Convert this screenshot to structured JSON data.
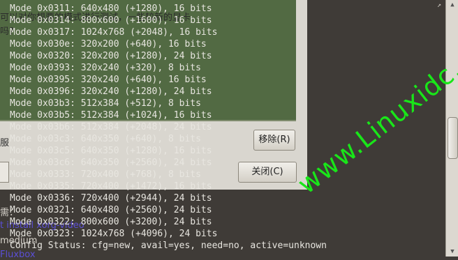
{
  "background_window": {
    "text_line_1": "可以对你想要的模式进行测试，一些较新的显卡",
    "text_line_2": "吗？",
    "text_line_3": "服",
    "text_line_4": "需：",
    "remove_button": "移除(R)",
    "close_button": "关闭(C)"
  },
  "background_page": {
    "link_text": "t install xorg-video",
    "word_1": "medium",
    "word_2": "Fluxbox"
  },
  "terminal": {
    "lines": [
      "Mode 0x0311: 640x480 (+1280), 16 bits",
      "Mode 0x0314: 800x600 (+1600), 16 bits",
      "Mode 0x0317: 1024x768 (+2048), 16 bits",
      "Mode 0x030e: 320x200 (+640), 16 bits",
      "Mode 0x0320: 320x200 (+1280), 24 bits",
      "Mode 0x0393: 320x240 (+320), 8 bits",
      "Mode 0x0395: 320x240 (+640), 16 bits",
      "Mode 0x0396: 320x240 (+1280), 24 bits",
      "Mode 0x03b3: 512x384 (+512), 8 bits",
      "Mode 0x03b5: 512x384 (+1024), 16 bits",
      "Mode 0x03b6: 512x384 (+2048), 24 bits",
      "Mode 0x03c3: 640x350 (+640), 8 bits",
      "Mode 0x03c5: 640x350 (+1280), 16 bits",
      "Mode 0x03c6: 640x350 (+2560), 24 bits",
      "Mode 0x0333: 720x400 (+768), 8 bits",
      "Mode 0x0335: 720x400 (+1472), 16 bits",
      "Mode 0x0336: 720x400 (+2944), 24 bits",
      "Mode 0x0321: 640x480 (+2560), 24 bits",
      "Mode 0x0322: 800x600 (+3200), 24 bits",
      "Mode 0x0323: 1024x768 (+4096), 24 bits",
      "Config Status: cfg=new, avail=yes, need=no, active=unknown"
    ]
  },
  "watermark": {
    "text": "www.Linuxidc.com"
  },
  "colors": {
    "terminal_text": "#e8e6e0",
    "terminal_bg": "#3f3b37",
    "green_panel": "#526a43",
    "watermark": "#19e619",
    "link": "#5b4fd6"
  },
  "icons": {
    "scroll_up": "triangle-up",
    "scroll_down": "triangle-down",
    "top_right": "arrow-glyph"
  }
}
